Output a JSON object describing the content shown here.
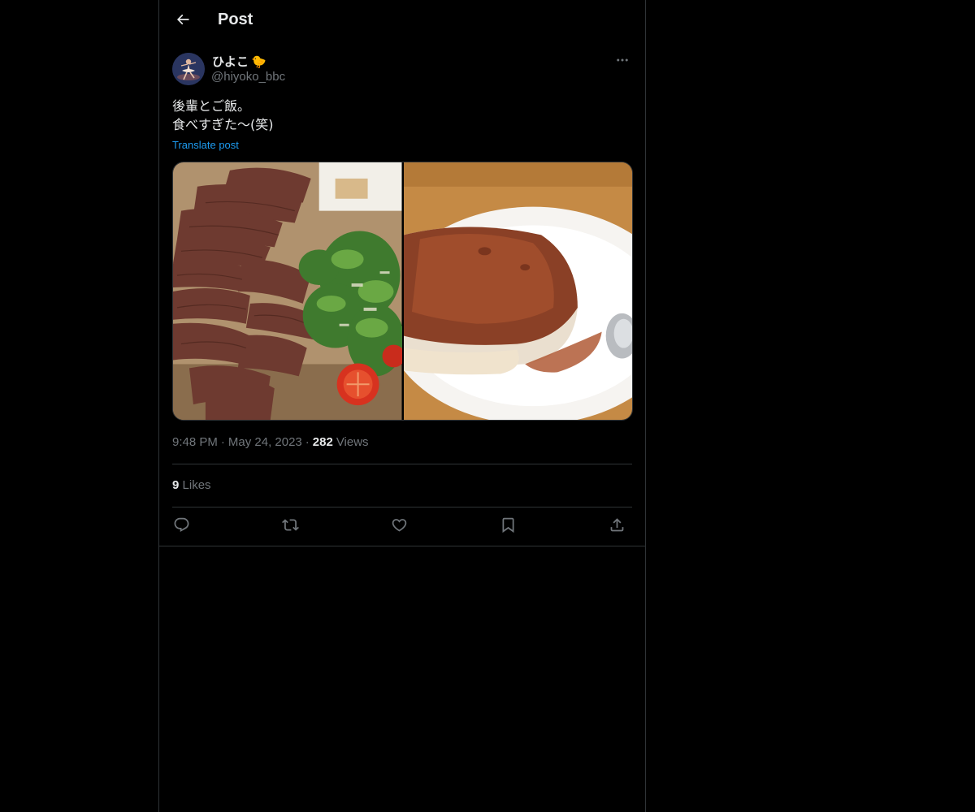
{
  "header": {
    "title": "Post"
  },
  "author": {
    "display_name": "ひよこ",
    "name_emoji": "🐤",
    "handle": "@hiyoko_bbc"
  },
  "post": {
    "lines": [
      "後輩とご飯。",
      "食べすぎた〜(笑)"
    ],
    "translate_label": "Translate post"
  },
  "media": [
    {
      "icon": "steak-salad-photo"
    },
    {
      "icon": "tiramisu-photo"
    }
  ],
  "meta": {
    "time": "9:48 PM",
    "separator": "·",
    "date": "May 24, 2023",
    "views_count": "282",
    "views_label": "Views"
  },
  "likes": {
    "count": "9",
    "label": "Likes"
  },
  "actions": [
    {
      "icon": "reply-icon"
    },
    {
      "icon": "repost-icon"
    },
    {
      "icon": "like-icon"
    },
    {
      "icon": "bookmark-icon"
    },
    {
      "icon": "share-icon"
    }
  ],
  "colors": {
    "background": "#000000",
    "text": "#e7e9ea",
    "secondary": "#71767b",
    "link": "#1d9bf0",
    "border": "#2f3336"
  }
}
